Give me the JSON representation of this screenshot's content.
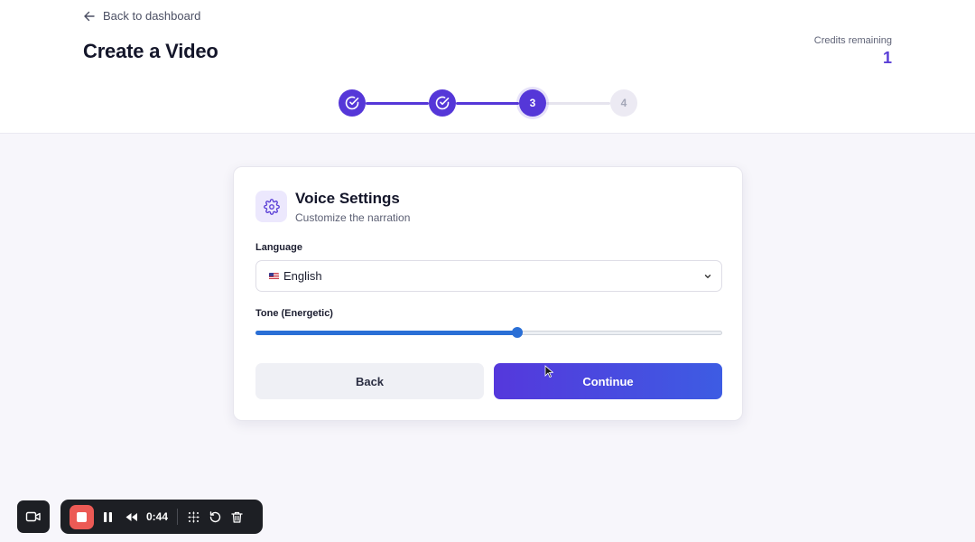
{
  "header": {
    "back_label": "Back to dashboard",
    "title": "Create a Video",
    "credits_label": "Credits remaining",
    "credits_value": "1"
  },
  "stepper": {
    "steps": [
      {
        "state": "completed",
        "icon": "check-circle-icon"
      },
      {
        "state": "completed",
        "icon": "check-circle-icon"
      },
      {
        "label": "3",
        "state": "active"
      },
      {
        "label": "4",
        "state": "pending"
      }
    ],
    "current_step": 3,
    "total_steps": 4
  },
  "card": {
    "icon": "gear-icon",
    "title": "Voice Settings",
    "subtitle": "Customize the narration",
    "language_label": "Language",
    "language_value": "English",
    "language_flag": "us-flag-icon",
    "tone_label": "Tone (Energetic)",
    "tone_level": 0.56,
    "back_button": "Back",
    "continue_button": "Continue"
  },
  "recorder": {
    "time": "0:44",
    "icons": [
      "camera-icon",
      "stop-icon",
      "pause-icon",
      "rewind-icon",
      "grid-icon",
      "restart-icon",
      "trash-icon"
    ]
  },
  "colors": {
    "accent": "#5537d8",
    "page_bg": "#f7f6fb",
    "slider": "#2a6fd6",
    "recorder_bg": "#1d1f24",
    "stop_red": "#ec5a55",
    "step_pending": "#eceaf3"
  }
}
